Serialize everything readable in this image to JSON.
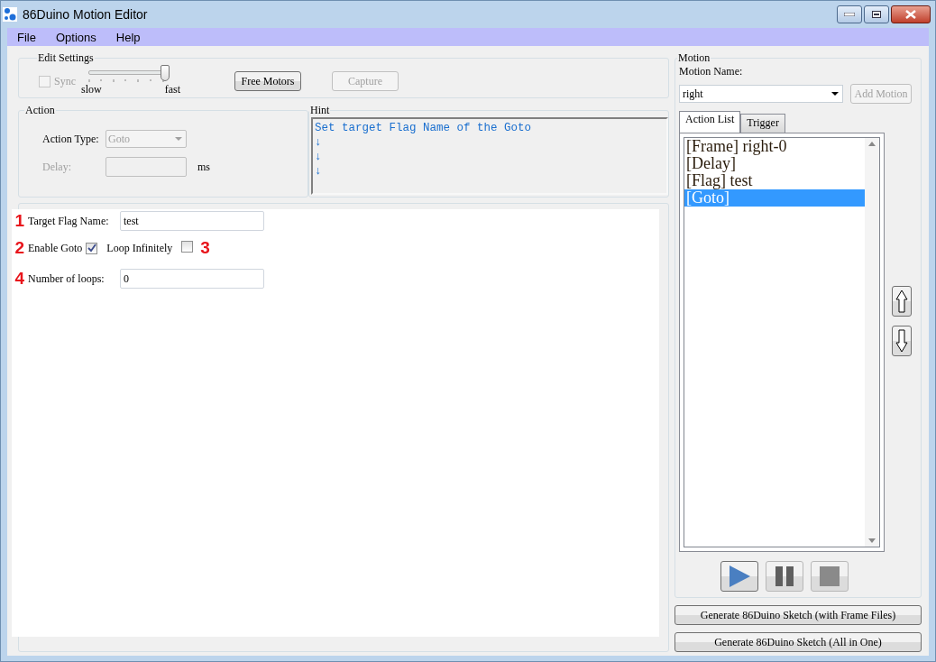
{
  "window": {
    "title": "86Duino Motion Editor"
  },
  "menu": [
    {
      "label": "File"
    },
    {
      "label": "Options"
    },
    {
      "label": "Help"
    }
  ],
  "edit_settings": {
    "title": "Edit Settings",
    "sync": {
      "label": "Sync",
      "checked": false,
      "disabled": true
    },
    "speed_slider": {
      "level": 1,
      "min_label": "slow",
      "max_label": "fast"
    },
    "buttons": [
      {
        "label": "Free Motors",
        "disabled": false
      },
      {
        "label": "Capture",
        "disabled": true
      }
    ]
  },
  "action": {
    "title": "Action",
    "action_type": {
      "label": "Action Type:",
      "value": "Goto",
      "disabled": true
    },
    "delay": {
      "label": "Delay:",
      "unit": "ms",
      "disabled": true
    }
  },
  "hint": {
    "title": "Hint",
    "lines": [
      "Set target Flag Name of the Goto",
      "↓",
      "↓",
      "↓"
    ]
  },
  "goto_settings": {
    "target_flag": {
      "marker": "1",
      "label": "Target Flag Name:",
      "value": "test"
    },
    "enable_goto": {
      "marker": "2",
      "label": "Enable Goto",
      "checked": true
    },
    "loop_infinitely": {
      "label": "Loop Infinitely",
      "checked": false,
      "marker": "3"
    },
    "number_of_loops": {
      "marker": "4",
      "label": "Number of loops:",
      "value": "0"
    }
  },
  "motion": {
    "title": "Motion",
    "name_label": "Motion Name:",
    "name_value": "right",
    "add_button": {
      "label": "Add Motion",
      "disabled": true
    },
    "tabs": [
      {
        "label": "Action List",
        "selected": true
      },
      {
        "label": "Trigger",
        "selected": false
      }
    ],
    "action_list": [
      {
        "label": "[Frame] right-0",
        "selected": false
      },
      {
        "label": "[Delay]",
        "selected": false
      },
      {
        "label": "[Flag] test",
        "selected": false
      },
      {
        "label": "[Goto]",
        "selected": true
      }
    ]
  },
  "generate_buttons": [
    {
      "label": "Generate 86Duino Sketch (with Frame Files)"
    },
    {
      "label": "Generate 86Duino Sketch (All in One)"
    }
  ]
}
